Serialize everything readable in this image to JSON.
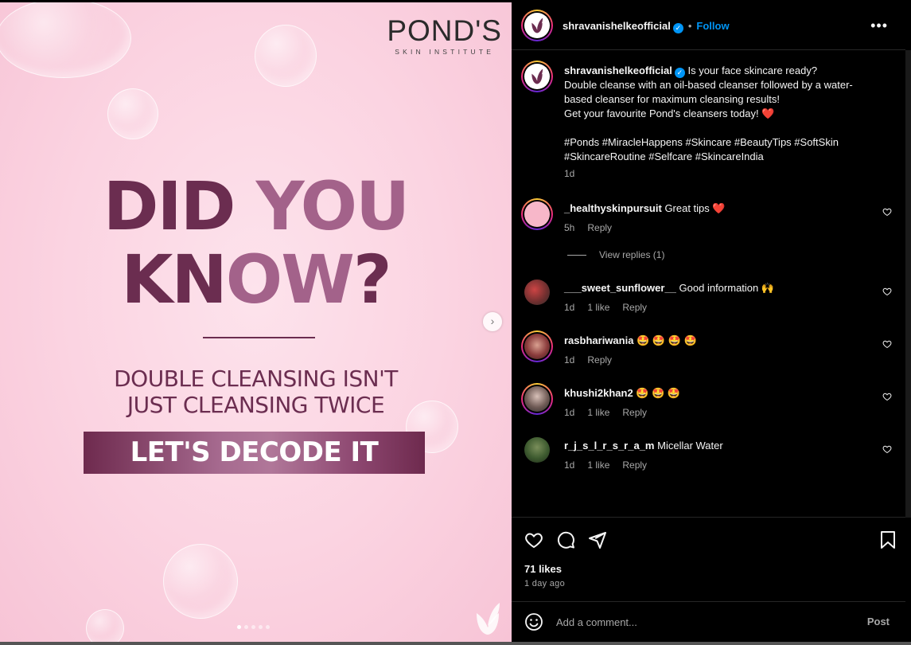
{
  "post_image": {
    "brand_name": "POND'S",
    "brand_sub": "SKIN INSTITUTE",
    "headline_line1_a": "DID ",
    "headline_line1_b": "YOU",
    "headline_line2_a": "KN",
    "headline_line2_b": "OW",
    "headline_line2_c": "?",
    "subline_1": "DOUBLE CLEANSING ISN'T",
    "subline_2": "JUST CLEANSING TWICE",
    "banner": "LET'S DECODE IT",
    "next_icon": "chevron-right-icon",
    "carousel_total": 5,
    "carousel_active": 1
  },
  "header": {
    "username": "shravanishelkeofficial",
    "verified": true,
    "separator": "•",
    "follow_label": "Follow",
    "more_icon": "more-horizontal-icon",
    "more_label": "•••"
  },
  "caption": {
    "username": "shravanishelkeofficial",
    "line1": "Is your face skincare ready?",
    "line2": "Double cleanse with an oil-based cleanser followed by a water-",
    "line3": "based cleanser for maximum cleansing results!",
    "line4": "Get your favourite Pond's cleansers today!",
    "emoji": "❤️",
    "hashtags_1": "#Ponds #MiracleHappens #Skincare #BeautyTips #SoftSkin",
    "hashtags_2": "#SkincareRoutine #Selfcare #SkincareIndia",
    "time": "1d"
  },
  "comments": [
    {
      "username": "_healthyskinpursuit",
      "text": "Great tips",
      "emoji": "❤️",
      "time": "5h",
      "likes": "",
      "reply": "Reply",
      "view_replies": "View replies (1)"
    },
    {
      "username": "___sweet_sunflower__",
      "text": "Good information",
      "emoji": "🙌",
      "time": "1d",
      "likes": "1 like",
      "reply": "Reply"
    },
    {
      "username": "rasbhariwania",
      "text": "",
      "emoji": "🤩 🤩 🤩 🤩",
      "time": "1d",
      "likes": "",
      "reply": "Reply"
    },
    {
      "username": "khushi2khan2",
      "text": "",
      "emoji": "🤩 🤩 🤩",
      "time": "1d",
      "likes": "1 like",
      "reply": "Reply"
    },
    {
      "username": "r_j_s_l_r_s_r_a_m",
      "text": "Micellar Water",
      "emoji": "",
      "time": "1d",
      "likes": "1 like",
      "reply": "Reply"
    }
  ],
  "actions": {
    "like_icon": "heart-icon",
    "comment_icon": "comment-icon",
    "share_icon": "share-icon",
    "save_icon": "bookmark-icon",
    "likes": "71 likes",
    "ago": "1 day ago"
  },
  "composer": {
    "emoji_icon": "smiley-icon",
    "placeholder": "Add a comment...",
    "post_label": "Post"
  },
  "colors": {
    "background": "#000000",
    "accent": "#0095f6",
    "like_red": "#ff3040",
    "brand_plum": "#6b2d50"
  }
}
